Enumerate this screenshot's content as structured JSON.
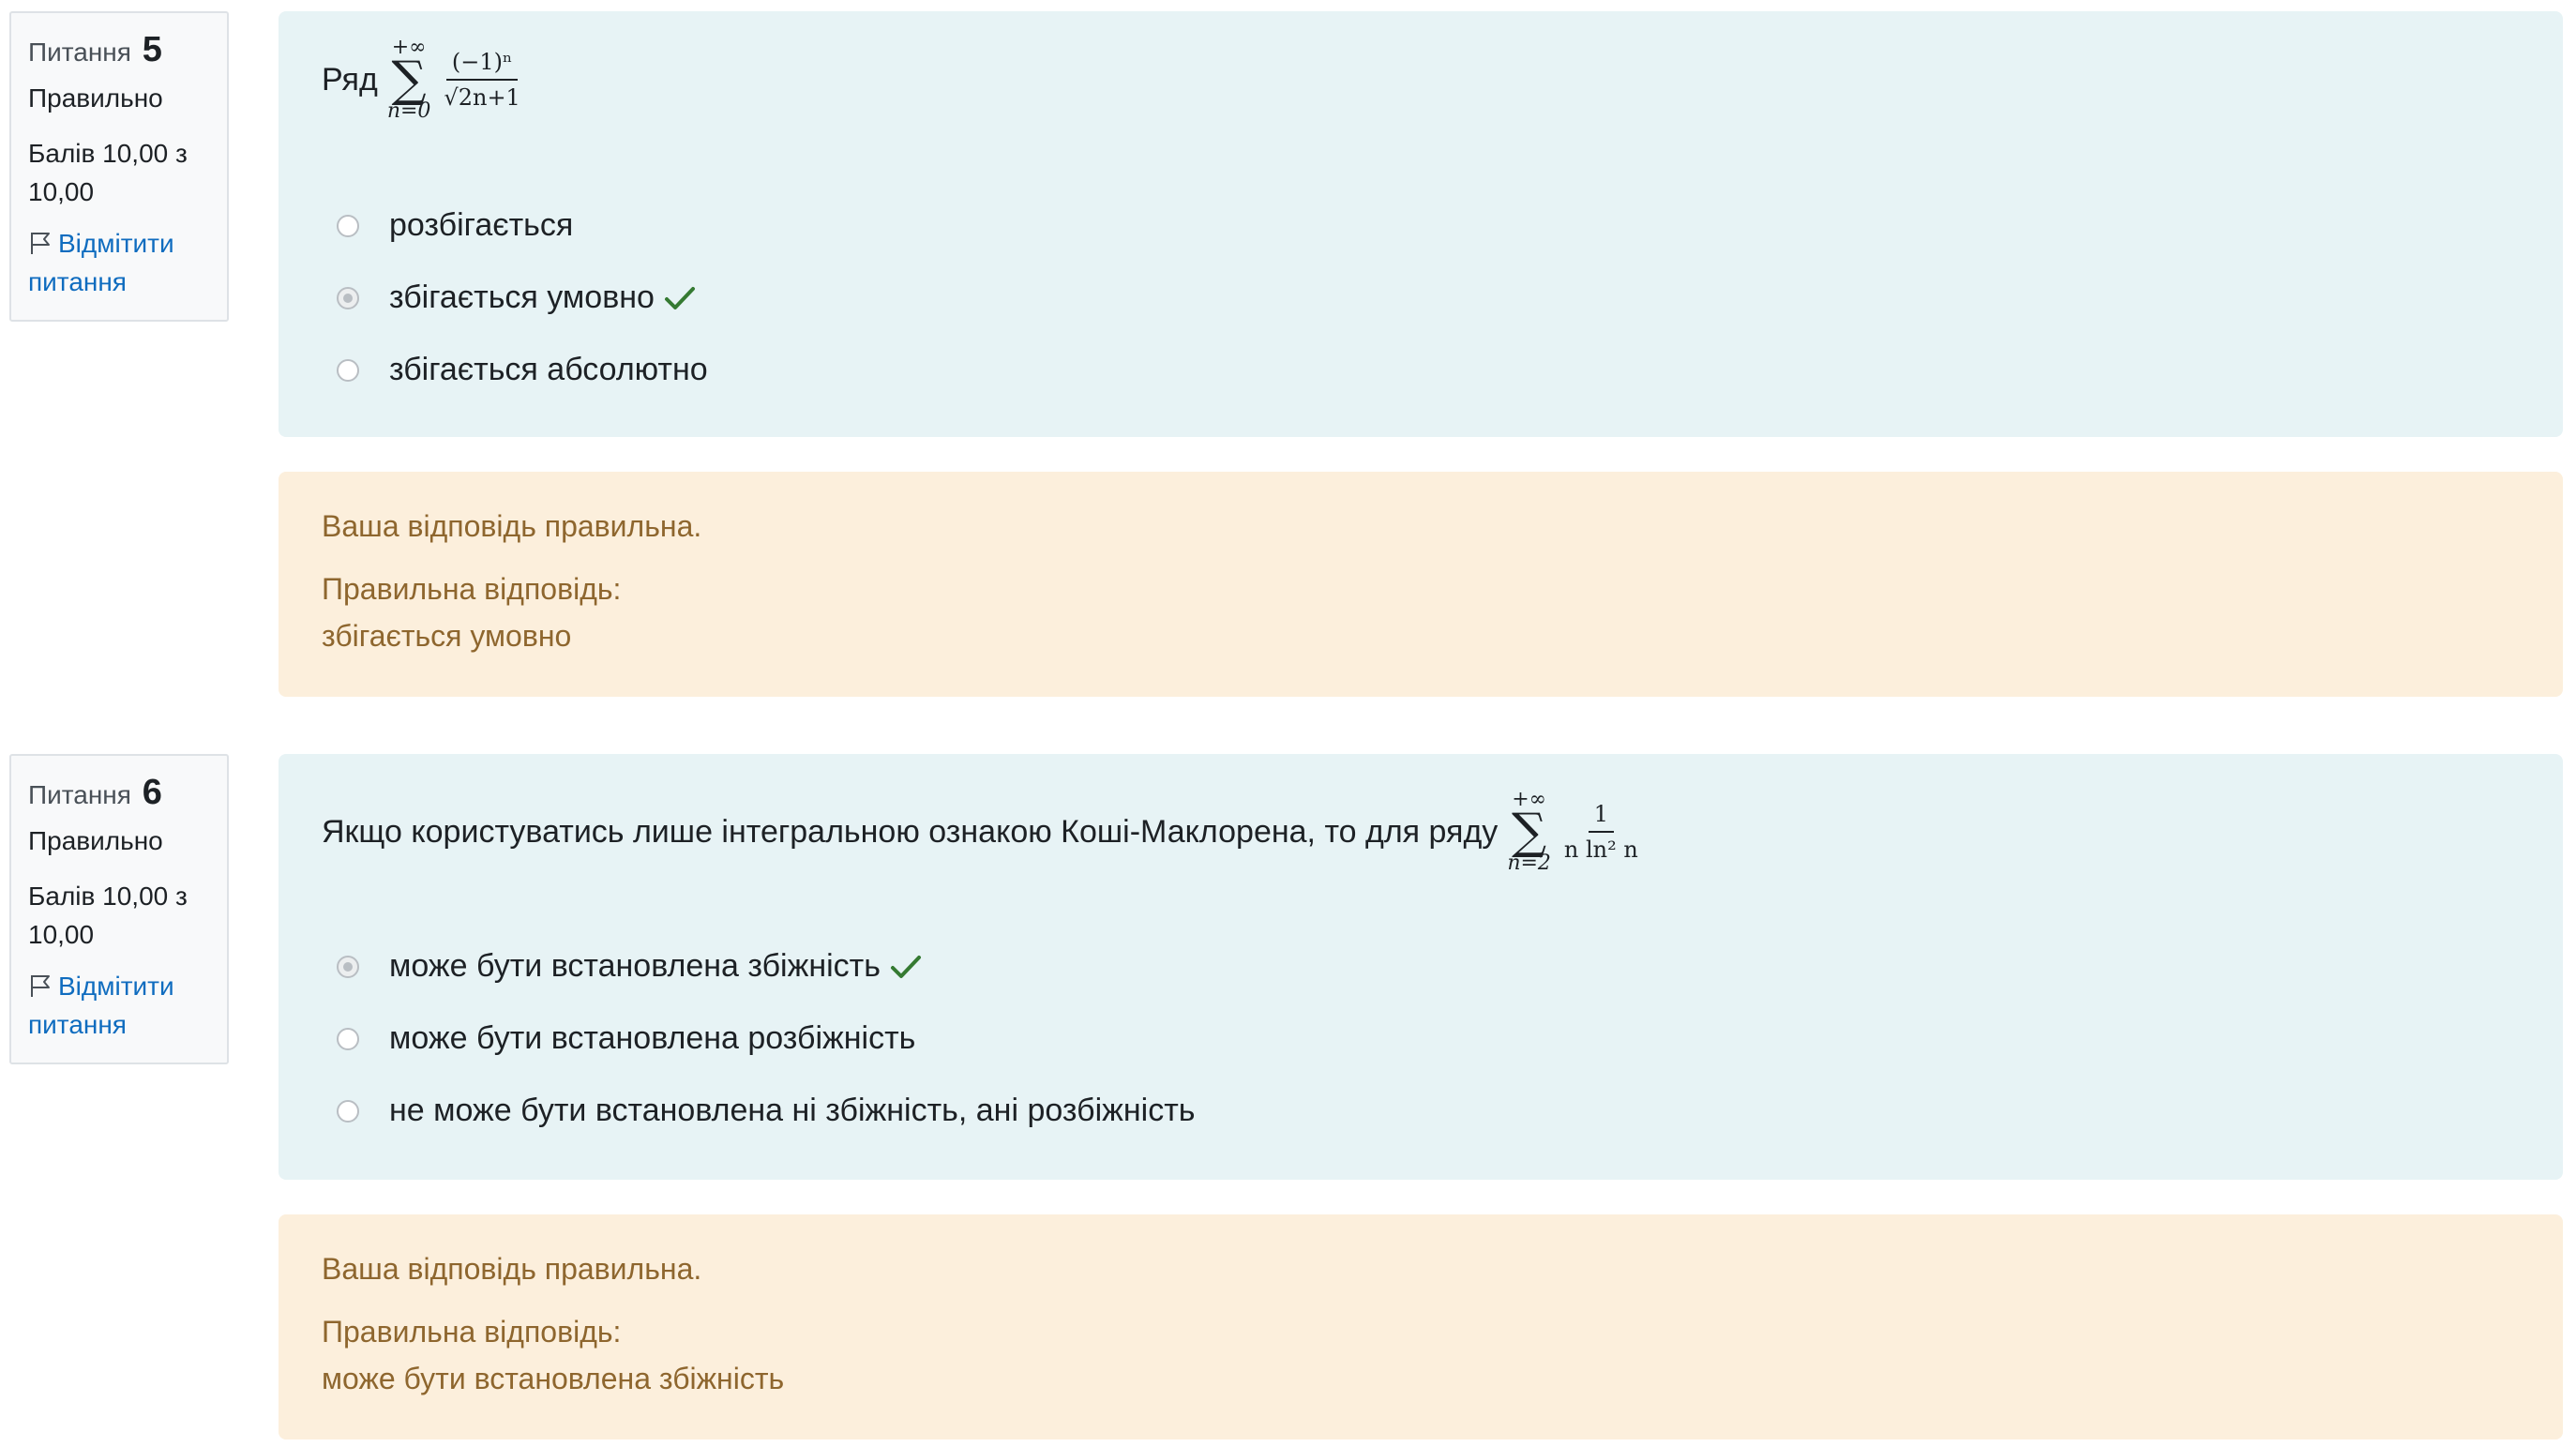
{
  "questions": [
    {
      "label": "Питання",
      "number": "5",
      "state": "Правильно",
      "grade": "Балів 10,00 з 10,00",
      "flag_label": "Відмітити питання",
      "text_prefix": "Ряд",
      "formula": {
        "sum_upper": "+∞",
        "sum_symbol": "∑",
        "sum_lower": "n=0",
        "numerator": "(−1)ⁿ",
        "denominator": "√2n+1"
      },
      "options": [
        {
          "label": "розбігається",
          "selected": false,
          "correct_mark": false
        },
        {
          "label": "збігається умовно",
          "selected": true,
          "correct_mark": true
        },
        {
          "label": "збігається абсолютно",
          "selected": false,
          "correct_mark": false
        }
      ],
      "feedback": {
        "result": "Ваша відповідь правильна.",
        "right_answer_label": "Правильна відповідь:",
        "right_answer": "збігається умовно"
      }
    },
    {
      "label": "Питання",
      "number": "6",
      "state": "Правильно",
      "grade": "Балів 10,00 з 10,00",
      "flag_label": "Відмітити питання",
      "text_prefix": "Якщо користуватись лише інтегральною ознакою Коші-Маклорена, то для ряду",
      "formula": {
        "sum_upper": "+∞",
        "sum_symbol": "∑",
        "sum_lower": "n=2",
        "numerator": "1",
        "denominator": "n ln² n"
      },
      "options": [
        {
          "label": "може бути встановлена збіжність",
          "selected": true,
          "correct_mark": true
        },
        {
          "label": "може бути встановлена розбіжність",
          "selected": false,
          "correct_mark": false
        },
        {
          "label": "не може бути встановлена ні збіжність, ані розбіжність",
          "selected": false,
          "correct_mark": false
        }
      ],
      "feedback": {
        "result": "Ваша відповідь правильна.",
        "right_answer_label": "Правильна відповідь:",
        "right_answer": "може бути встановлена збіжність"
      }
    }
  ],
  "icons": {
    "flag": "flag-icon",
    "correct": "check-icon"
  },
  "colors": {
    "formulation_bg": "#e7f3f5",
    "feedback_bg": "#fcefdc",
    "feedback_text": "#8e662e",
    "link": "#0f6cbf",
    "correct_tick": "#357a32"
  }
}
